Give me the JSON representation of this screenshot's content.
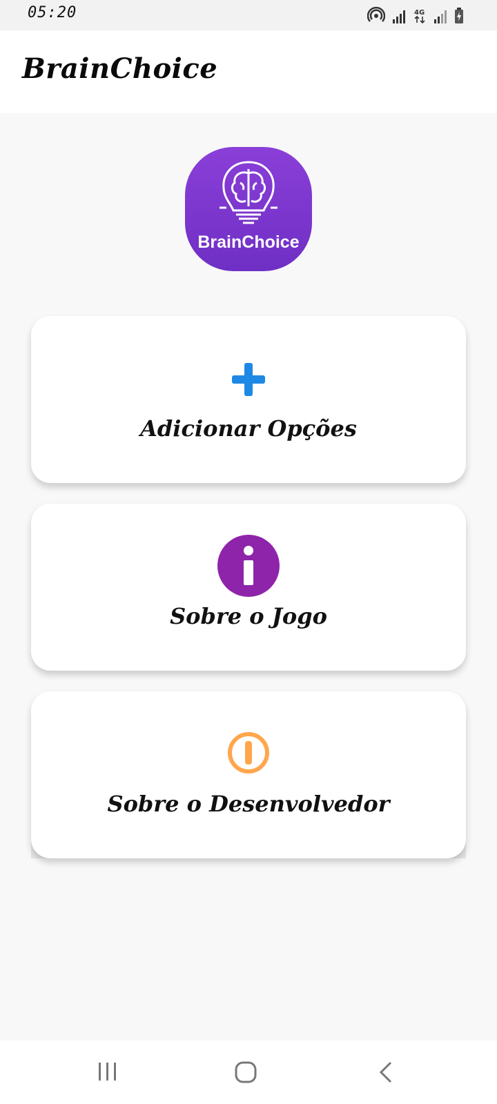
{
  "status_bar": {
    "time": "05:20"
  },
  "app_bar": {
    "title": "BrainChoice"
  },
  "logo": {
    "text": "BrainChoice",
    "color": "#7b3fd3"
  },
  "menu": [
    {
      "label": "Adicionar Opções",
      "icon": "plus-icon",
      "icon_color": "#1e88e5"
    },
    {
      "label": "Sobre o Jogo",
      "icon": "info-icon",
      "icon_color": "#8e24aa"
    },
    {
      "label": "Sobre o Desenvolvedor",
      "icon": "alert-circle-icon",
      "icon_color": "#ffa64d"
    }
  ],
  "nav_bar": {
    "buttons": [
      "recent-apps",
      "home",
      "back"
    ]
  }
}
